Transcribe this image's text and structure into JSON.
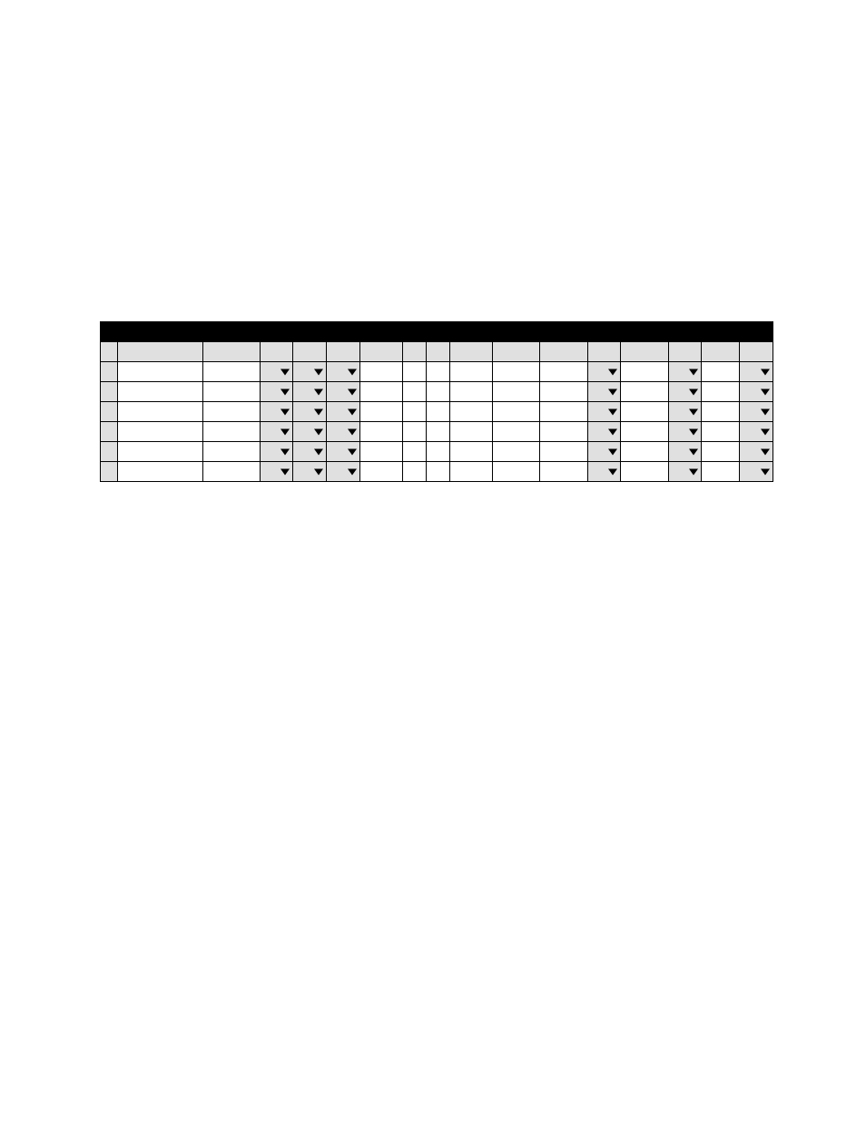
{
  "table": {
    "title": "",
    "columns": 17,
    "dropdown_columns": [
      3,
      4,
      5,
      12,
      14,
      16
    ],
    "header_cells": [
      "",
      "",
      "",
      "",
      "",
      "",
      "",
      "",
      "",
      "",
      "",
      "",
      "",
      "",
      "",
      "",
      ""
    ],
    "rows": [
      [
        "",
        "",
        "",
        "",
        "",
        "",
        "",
        "",
        "",
        "",
        "",
        "",
        "",
        "",
        "",
        "",
        ""
      ],
      [
        "",
        "",
        "",
        "",
        "",
        "",
        "",
        "",
        "",
        "",
        "",
        "",
        "",
        "",
        "",
        "",
        ""
      ],
      [
        "",
        "",
        "",
        "",
        "",
        "",
        "",
        "",
        "",
        "",
        "",
        "",
        "",
        "",
        "",
        "",
        ""
      ],
      [
        "",
        "",
        "",
        "",
        "",
        "",
        "",
        "",
        "",
        "",
        "",
        "",
        "",
        "",
        "",
        "",
        ""
      ],
      [
        "",
        "",
        "",
        "",
        "",
        "",
        "",
        "",
        "",
        "",
        "",
        "",
        "",
        "",
        "",
        "",
        ""
      ],
      [
        "",
        "",
        "",
        "",
        "",
        "",
        "",
        "",
        "",
        "",
        "",
        "",
        "",
        "",
        "",
        "",
        ""
      ]
    ]
  }
}
